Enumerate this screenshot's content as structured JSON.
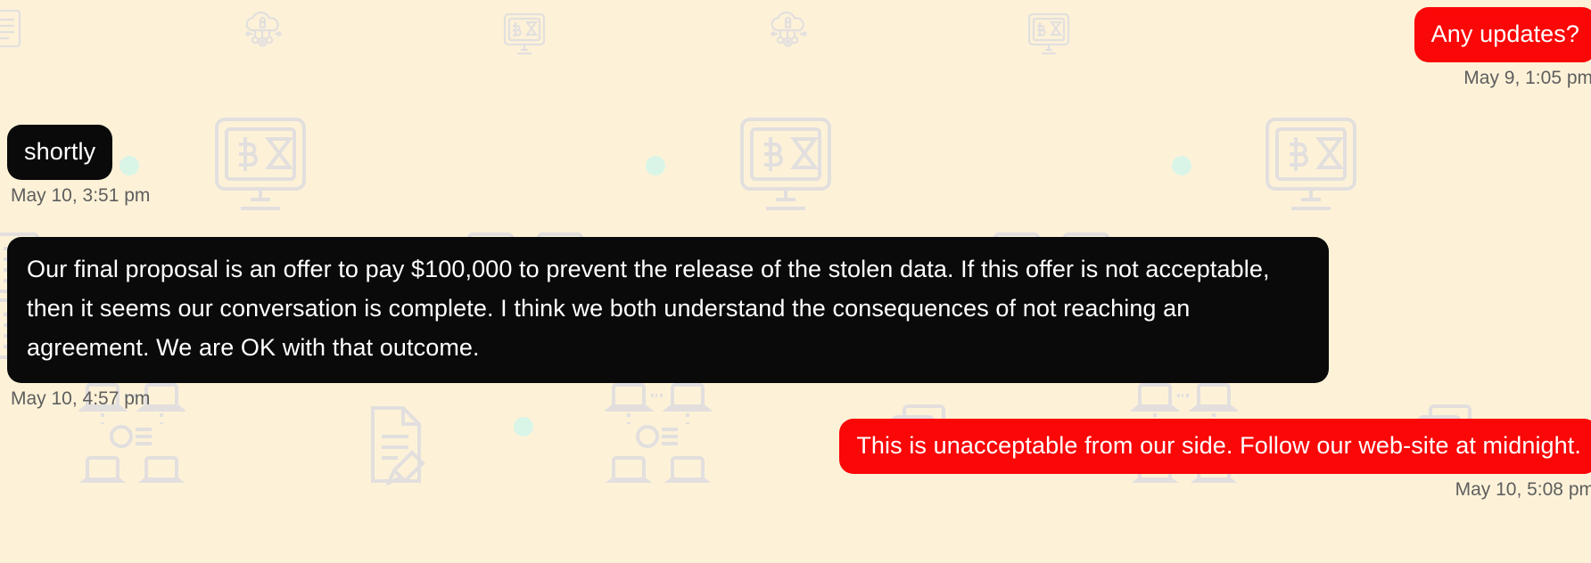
{
  "theme": {
    "background_color": "#fdf2d8",
    "outgoing_bubble_color": "#fa0707",
    "incoming_bubble_color": "#0a0a0a",
    "bubble_text_color": "#ffffff",
    "timestamp_color": "#5e5e5e",
    "watermark_color": "#dedce0",
    "accent_dot_color": "#d9f5e8"
  },
  "conversation": {
    "messages": [
      {
        "id": "any-updates",
        "side": "outgoing",
        "text": "Any updates?",
        "timestamp": "May 9, 1:05 pm"
      },
      {
        "id": "shortly",
        "side": "incoming",
        "text": "shortly",
        "timestamp": "May 10, 3:51 pm"
      },
      {
        "id": "proposal",
        "side": "incoming",
        "text": "Our final proposal is an offer to pay $100,000 to prevent the release of the stolen data. If this offer is not acceptable, then it seems our conversation is complete. I think we both understand the consequences of not reaching an agreement. We are OK with that outcome.",
        "timestamp": "May 10, 4:57 pm"
      },
      {
        "id": "unacceptable",
        "side": "outgoing",
        "text": "This is unacceptable from our side. Follow our web-site at midnight.",
        "timestamp": "May 10, 5:08 pm"
      }
    ]
  },
  "watermarks": {
    "icon_names": [
      "cloud-lock-icon",
      "monitor-bitcoin-hourglass-icon",
      "laptop-network-icon",
      "document-pencil-icon",
      "documents-stack-icon"
    ]
  }
}
